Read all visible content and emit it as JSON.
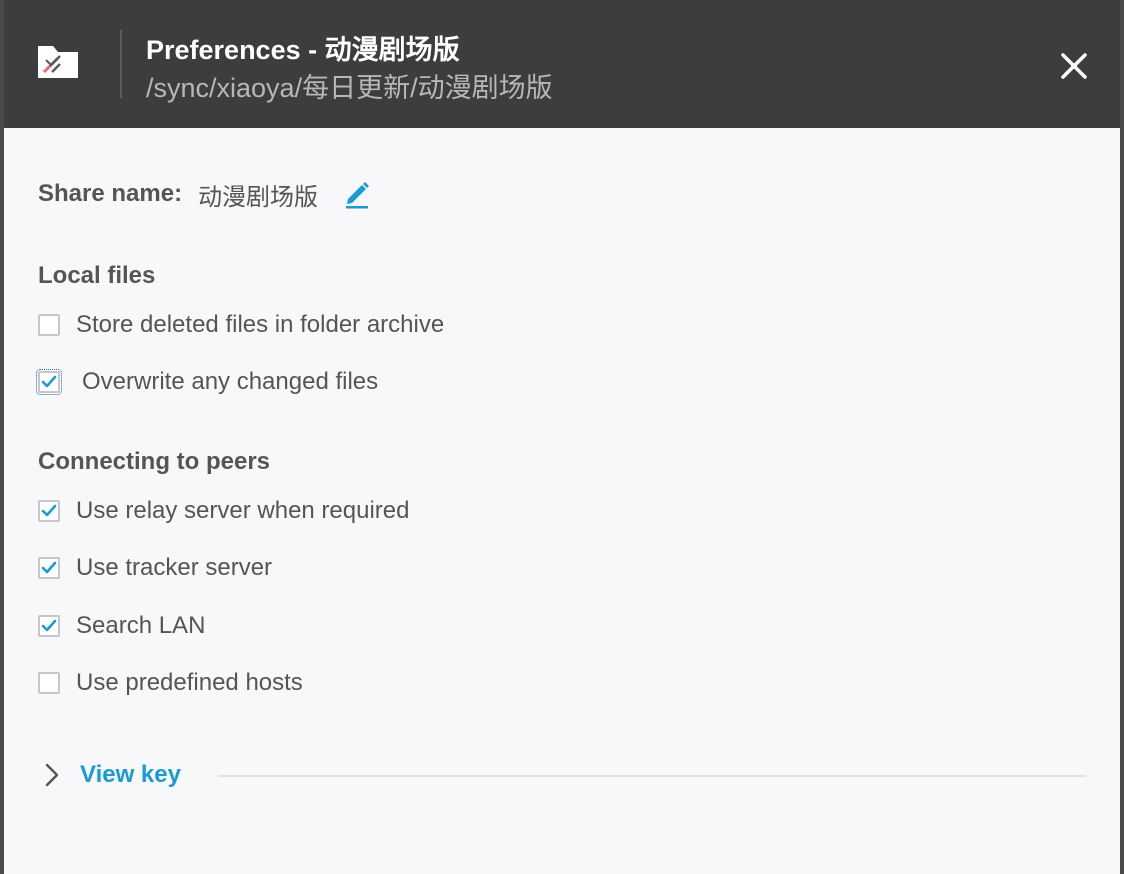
{
  "header": {
    "title": "Preferences - 动漫剧场版",
    "path": "/sync/xiaoya/每日更新/动漫剧场版",
    "folder_icon": "folder-disconnected-icon",
    "close_icon": "close-icon"
  },
  "share": {
    "label": "Share name:",
    "value": "动漫剧场版",
    "edit_icon": "pencil-icon"
  },
  "local_files": {
    "title": "Local files",
    "options": [
      {
        "label": "Store deleted files in folder archive",
        "checked": false
      },
      {
        "label": "Overwrite any changed files",
        "checked": true
      }
    ]
  },
  "peers": {
    "title": "Connecting to peers",
    "options": [
      {
        "label": "Use relay server when required",
        "checked": true
      },
      {
        "label": "Use tracker server",
        "checked": true
      },
      {
        "label": "Search LAN",
        "checked": true
      },
      {
        "label": "Use predefined hosts",
        "checked": false
      }
    ]
  },
  "view_key": {
    "label": "View key",
    "icon": "chevron-right-icon"
  },
  "colors": {
    "header_bg": "#3d3d3f",
    "accent": "#1a9ad6",
    "text": "#555557"
  }
}
